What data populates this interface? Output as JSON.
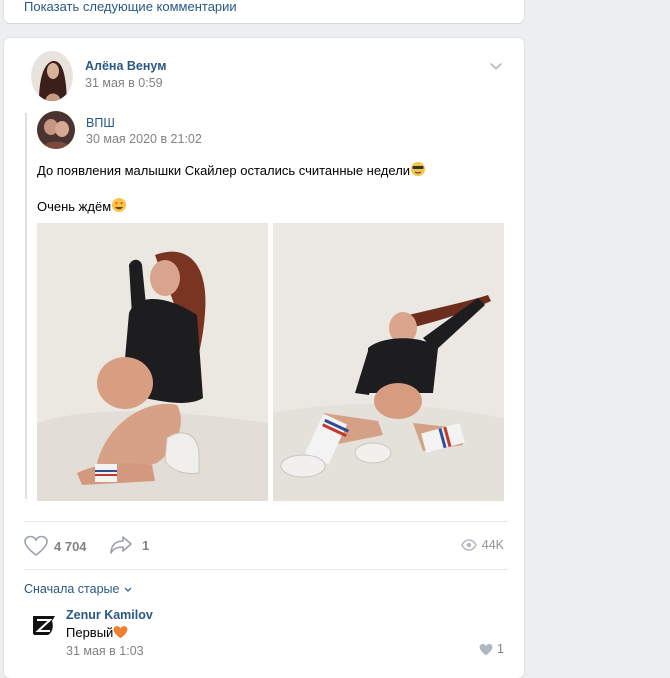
{
  "top": {
    "more_comments": "Показать следующие комментарии"
  },
  "post": {
    "author_name": "Алёна Венум",
    "author_date": "31 мая в 0:59",
    "repost": {
      "name": "ВПШ",
      "date": "30 мая 2020 в 21:02",
      "text_line1": "До появления малышки Скайлер остались считанные недели",
      "text_line2": "Очень ждём"
    },
    "likes": "4 704",
    "shares": "1",
    "views": "44K",
    "icons": {
      "menu": "chevron-down-icon",
      "like": "heart-icon",
      "share": "share-arrow-icon",
      "views": "eye-icon"
    }
  },
  "comments": {
    "sort_label": "Сначала старые",
    "items": [
      {
        "name": "Zenur Kamilov",
        "text": "Первый",
        "date": "31 мая в 1:03",
        "likes": "1"
      }
    ]
  },
  "colors": {
    "link": "#2a5885",
    "muted": "#828282",
    "background": "#edeef0"
  }
}
